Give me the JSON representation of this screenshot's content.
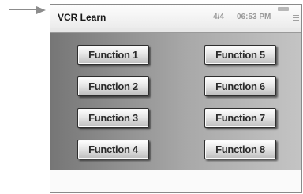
{
  "window": {
    "title": "VCR Learn",
    "page_indicator": "4/4",
    "time": "06:53 PM"
  },
  "icons": [
    "arrow-pointer-icon",
    "battery-icon",
    "menu-icon"
  ],
  "buttons": [
    {
      "label": "Function 1"
    },
    {
      "label": "Function 5"
    },
    {
      "label": "Function 2"
    },
    {
      "label": "Function 6"
    },
    {
      "label": "Function 3"
    },
    {
      "label": "Function 7"
    },
    {
      "label": "Function 4"
    },
    {
      "label": "Function 8"
    }
  ]
}
